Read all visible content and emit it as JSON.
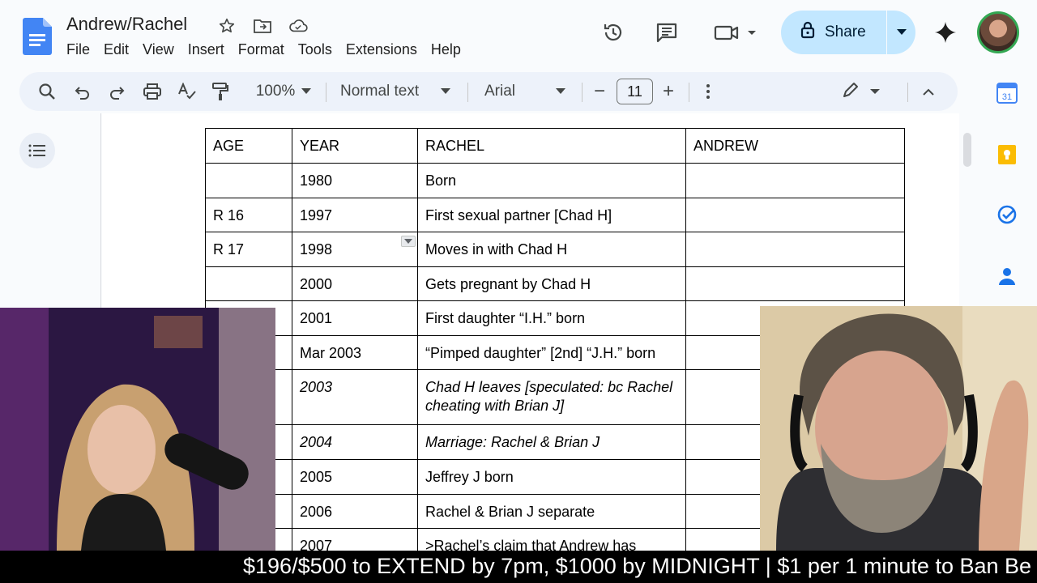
{
  "document": {
    "title": "Andrew/Rachel"
  },
  "menu": [
    "File",
    "Edit",
    "View",
    "Insert",
    "Format",
    "Tools",
    "Extensions",
    "Help"
  ],
  "share": {
    "label": "Share"
  },
  "toolbar": {
    "zoom": "100%",
    "style": "Normal text",
    "font": "Arial",
    "font_size": "11",
    "minus": "−",
    "plus": "+"
  },
  "table": {
    "headers": [
      "AGE",
      "YEAR",
      "RACHEL",
      "ANDREW"
    ],
    "rows": [
      [
        "",
        "1980",
        "Born",
        ""
      ],
      [
        "R 16",
        "1997",
        "First sexual partner [Chad H]",
        ""
      ],
      [
        "R 17",
        "1998",
        "Moves in with Chad H",
        ""
      ],
      [
        "",
        "2000",
        "Gets pregnant by Chad H",
        ""
      ],
      [
        "",
        "2001",
        "First daughter “I.H.” born",
        ""
      ],
      [
        "",
        "Mar 2003",
        "“Pimped daughter” [2nd] “J.H.” born",
        ""
      ],
      [
        "",
        "2003",
        "Chad H leaves [speculated: bc Rachel cheating with Brian J]",
        ""
      ],
      [
        "",
        "2004",
        "Marriage: Rachel & Brian J",
        ""
      ],
      [
        "",
        "2005",
        "Jeffrey J born",
        ""
      ],
      [
        "",
        "2006",
        "Rachel & Brian J separate",
        ""
      ],
      [
        "",
        "2007",
        ">Rachel’s claim that Andrew has",
        ""
      ]
    ]
  },
  "ticker": {
    "text": "$196/$500 to EXTEND by 7pm, $1000 by MIDNIGHT | $1 per 1 minute to Ban Be"
  },
  "colors": {
    "share_bg": "#c2e7ff",
    "toolbar_bg": "#edf2fa",
    "docs_blue": "#4285f4"
  }
}
